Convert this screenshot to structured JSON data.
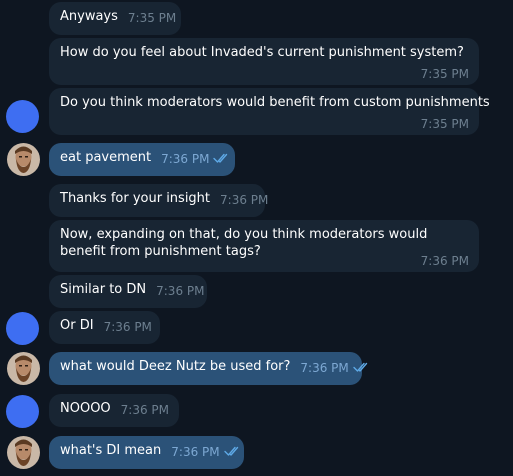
{
  "messages": [
    {
      "text": "Anyways",
      "time": "7:35 PM"
    },
    {
      "text": "How do you feel about Invaded's current punishment system?",
      "time": "7:35 PM"
    },
    {
      "text": "Do you think moderators would benefit from custom punishments",
      "time": "7:35 PM"
    },
    {
      "text": "eat pavement",
      "time": "7:36 PM"
    },
    {
      "text": "Thanks for your insight",
      "time": "7:36 PM"
    },
    {
      "text": "Now, expanding on that, do you think moderators would benefit from punishment tags?",
      "time": "7:36 PM"
    },
    {
      "text": "Similar to DN",
      "time": "7:36 PM"
    },
    {
      "text": "Or DI",
      "time": "7:36 PM"
    },
    {
      "text": "what would Deez Nutz be used for?",
      "time": "7:36 PM"
    },
    {
      "text": "NOOOO",
      "time": "7:36 PM"
    },
    {
      "text": "what's DI mean",
      "time": "7:36 PM"
    }
  ],
  "colors": {
    "background": "#0e1621",
    "incoming_bubble": "#182533",
    "outgoing_bubble": "#2b5278",
    "avatar_blue": "#3e6ef2",
    "read_ticks": "#5ea9e6"
  },
  "icons": {
    "read_status": "double-check-icon",
    "participant_avatar": "blue-circle-avatar",
    "user_avatar": "bearded-man-photo-avatar"
  }
}
